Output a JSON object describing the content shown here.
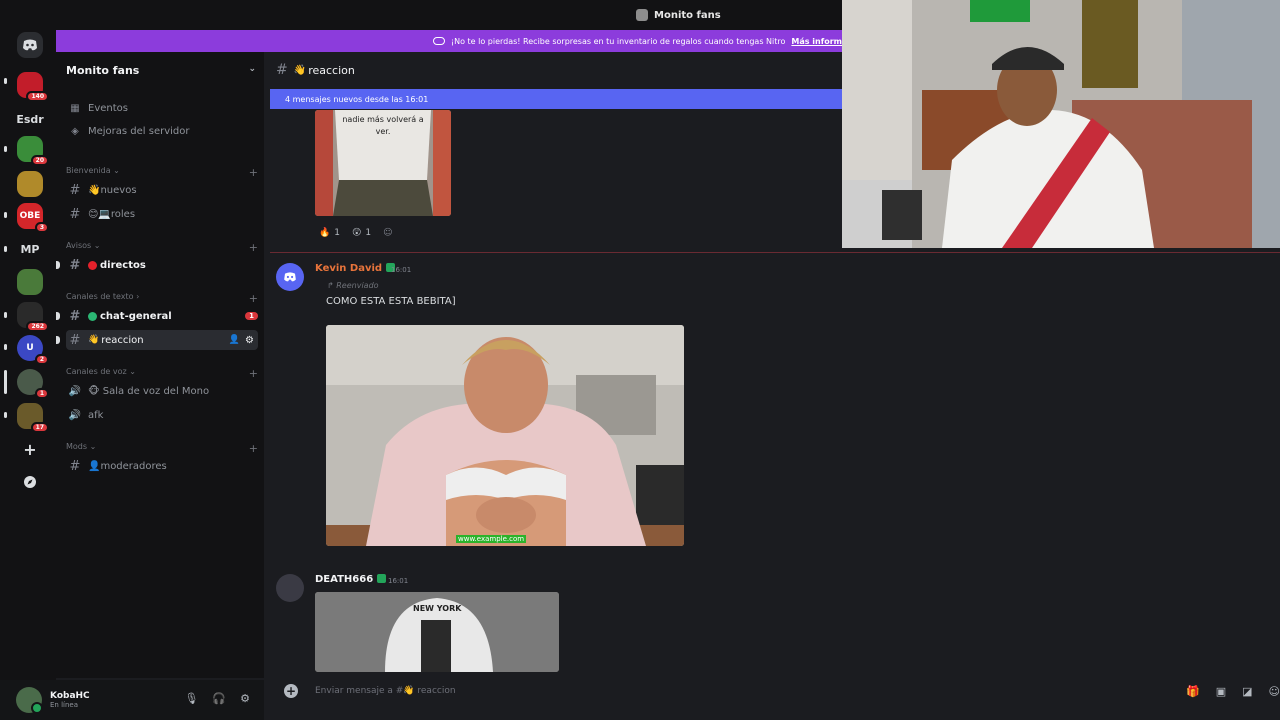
{
  "window": {
    "title": "Monito fans"
  },
  "rail": {
    "items": [
      {
        "label": "",
        "badge": "140",
        "color": "#c21d2a"
      },
      {
        "label": "Esdr",
        "badge": "",
        "color": ""
      },
      {
        "label": "",
        "badge": "20",
        "color": "#3a8d3a"
      },
      {
        "label": "",
        "badge": "",
        "color": "#b08a2a"
      },
      {
        "label": "OBE",
        "badge": "3",
        "color": "#d4262a"
      },
      {
        "label": "MP",
        "badge": "",
        "color": ""
      },
      {
        "label": "",
        "badge": "",
        "color": "#4a7a3a"
      },
      {
        "label": "",
        "badge": "262",
        "color": "#2a2a2a"
      },
      {
        "label": "U",
        "badge": "2",
        "color": "#3b48c4"
      },
      {
        "label": "",
        "badge": "1",
        "color": "#4a5a4a"
      },
      {
        "label": "",
        "badge": "17",
        "color": "#6a5a2a"
      }
    ]
  },
  "sidebar": {
    "server_name": "Monito fans",
    "events": "Eventos",
    "boosts": "Mejoras del servidor",
    "categories": [
      {
        "name": "Bienvenida",
        "channels": [
          "👋nuevos",
          "😊💻roles"
        ]
      },
      {
        "name": "Avisos",
        "channels": [
          "directos"
        ]
      },
      {
        "name": "Canales de texto",
        "channels": [
          "chat-general",
          "reaccion"
        ]
      },
      {
        "name": "Canales de voz",
        "channels": [
          "🐵 Sala de voz del Mono",
          "afk"
        ]
      },
      {
        "name": "Mods",
        "channels": [
          "👤moderadores"
        ]
      }
    ],
    "chat_general_badge": "1"
  },
  "user": {
    "name": "KobaHC",
    "status": "En línea"
  },
  "banner": {
    "text": "¡No te lo pierdas! Recibe sorpresas en tu inventario de regalos cuando tengas Nitro",
    "link": "Más inform"
  },
  "channel": {
    "name": "reaccion",
    "new_messages": "4 mensajes nuevos desde las 16:01",
    "placeholder": "Enviar mensaje a #👋 reaccion"
  },
  "first_image_caption": "nadie más volverá a ver.",
  "reactions": [
    {
      "emoji": "🔥",
      "count": "1"
    },
    {
      "emoji": "😲",
      "count": "1"
    }
  ],
  "messages": [
    {
      "author": "Kevin David",
      "author_color": "#e8743b",
      "time": "16:01",
      "forwarded": "Reenviado",
      "text": "COMO ESTA ESTA BEBITA]",
      "watermark": "www.example.com"
    },
    {
      "author": "DEATH666",
      "author_color": "#f2f3f5",
      "time": "16:01",
      "image_text": "NEW YORK"
    }
  ]
}
